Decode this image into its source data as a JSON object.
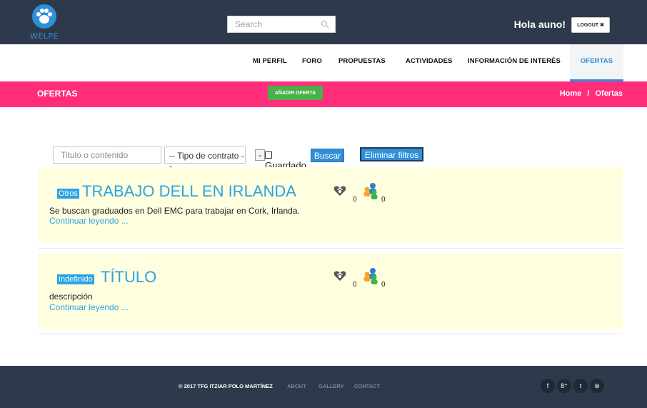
{
  "header": {
    "logo_text": "WELPE",
    "search_placeholder": "Search",
    "greeting": "Hola auno!",
    "logout_label": "LOGOUT ✖"
  },
  "nav": {
    "items": [
      "MI PERFIL",
      "FORO",
      "PROPUESTAS",
      "ACTIVIDADES",
      "INFORMACIÓN DE INTERÉS",
      "OFERTAS"
    ],
    "active": "OFERTAS"
  },
  "section": {
    "title": "OFERTAS",
    "add_label": "AÑADIR OFERTA",
    "breadcrumb_home": "Home",
    "breadcrumb_sep": "/",
    "breadcrumb_current": "Ofertas"
  },
  "filters": {
    "title_placeholder": "Titulo o contenido",
    "contract_selected": "-- Tipo de contrato --",
    "saved_label": "Guardado",
    "search_label": "Buscar",
    "clear_label": "Eliminar filtros"
  },
  "offers": [
    {
      "tag": "Otros",
      "title": "TRABAJO DELL EN IRLANDA",
      "description": "Se buscan graduados en Dell EMC para trabajar en Cork, Irlanda.",
      "more": "Continuar leyendo ...",
      "likes": "0",
      "applicants": "0"
    },
    {
      "tag": "Indefinido",
      "title": "TÍTULO",
      "description": "descripción",
      "more": "Continuar leyendo ...",
      "likes": "0",
      "applicants": "0"
    }
  ],
  "footer": {
    "copyright": "© 2017 TFG ITZIAR POLO MARTÍNEZ",
    "links": [
      "ABOUT",
      "GALLERY",
      "CONTACT"
    ],
    "social": [
      "f",
      "8⁺",
      "t",
      "⊛"
    ]
  },
  "colors": {
    "header_bg": "#2e3a4c",
    "accent_blue": "#2aa3e5",
    "pink": "#ff2d7a",
    "green": "#49b04a",
    "offer_bg": "#ffffe0"
  }
}
